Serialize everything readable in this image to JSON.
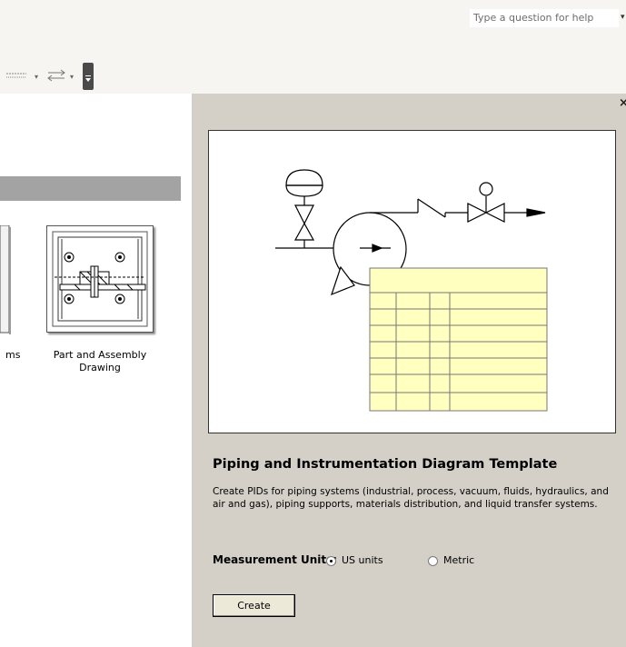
{
  "toolbar": {
    "help_placeholder": "Type a question for help",
    "icons": [
      "line-style-icon",
      "line-ends-icon",
      "toolbar-options-icon"
    ]
  },
  "gallery": {
    "partial_item_label": "ms",
    "items": [
      {
        "label": "Part and Assembly\nDrawing",
        "icon": "part-assembly-thumbnail-icon"
      }
    ]
  },
  "detail": {
    "close_label": "×",
    "template_title": "Piping and Instrumentation Diagram Template",
    "description": "Create PIDs for piping systems (industrial,  process, vacuum, fluids, hydraulics, and air and gas), piping supports, materials distribution, and liquid transfer systems.",
    "measurement_label": "Measurement Units:",
    "units": [
      {
        "label": "US units",
        "selected": true
      },
      {
        "label": "Metric",
        "selected": false
      }
    ],
    "create_label": "Create"
  },
  "colors": {
    "pane_bg": "#d4d0c8",
    "group_header": "#a3a3a3",
    "table_fill": "#ffffc0"
  }
}
